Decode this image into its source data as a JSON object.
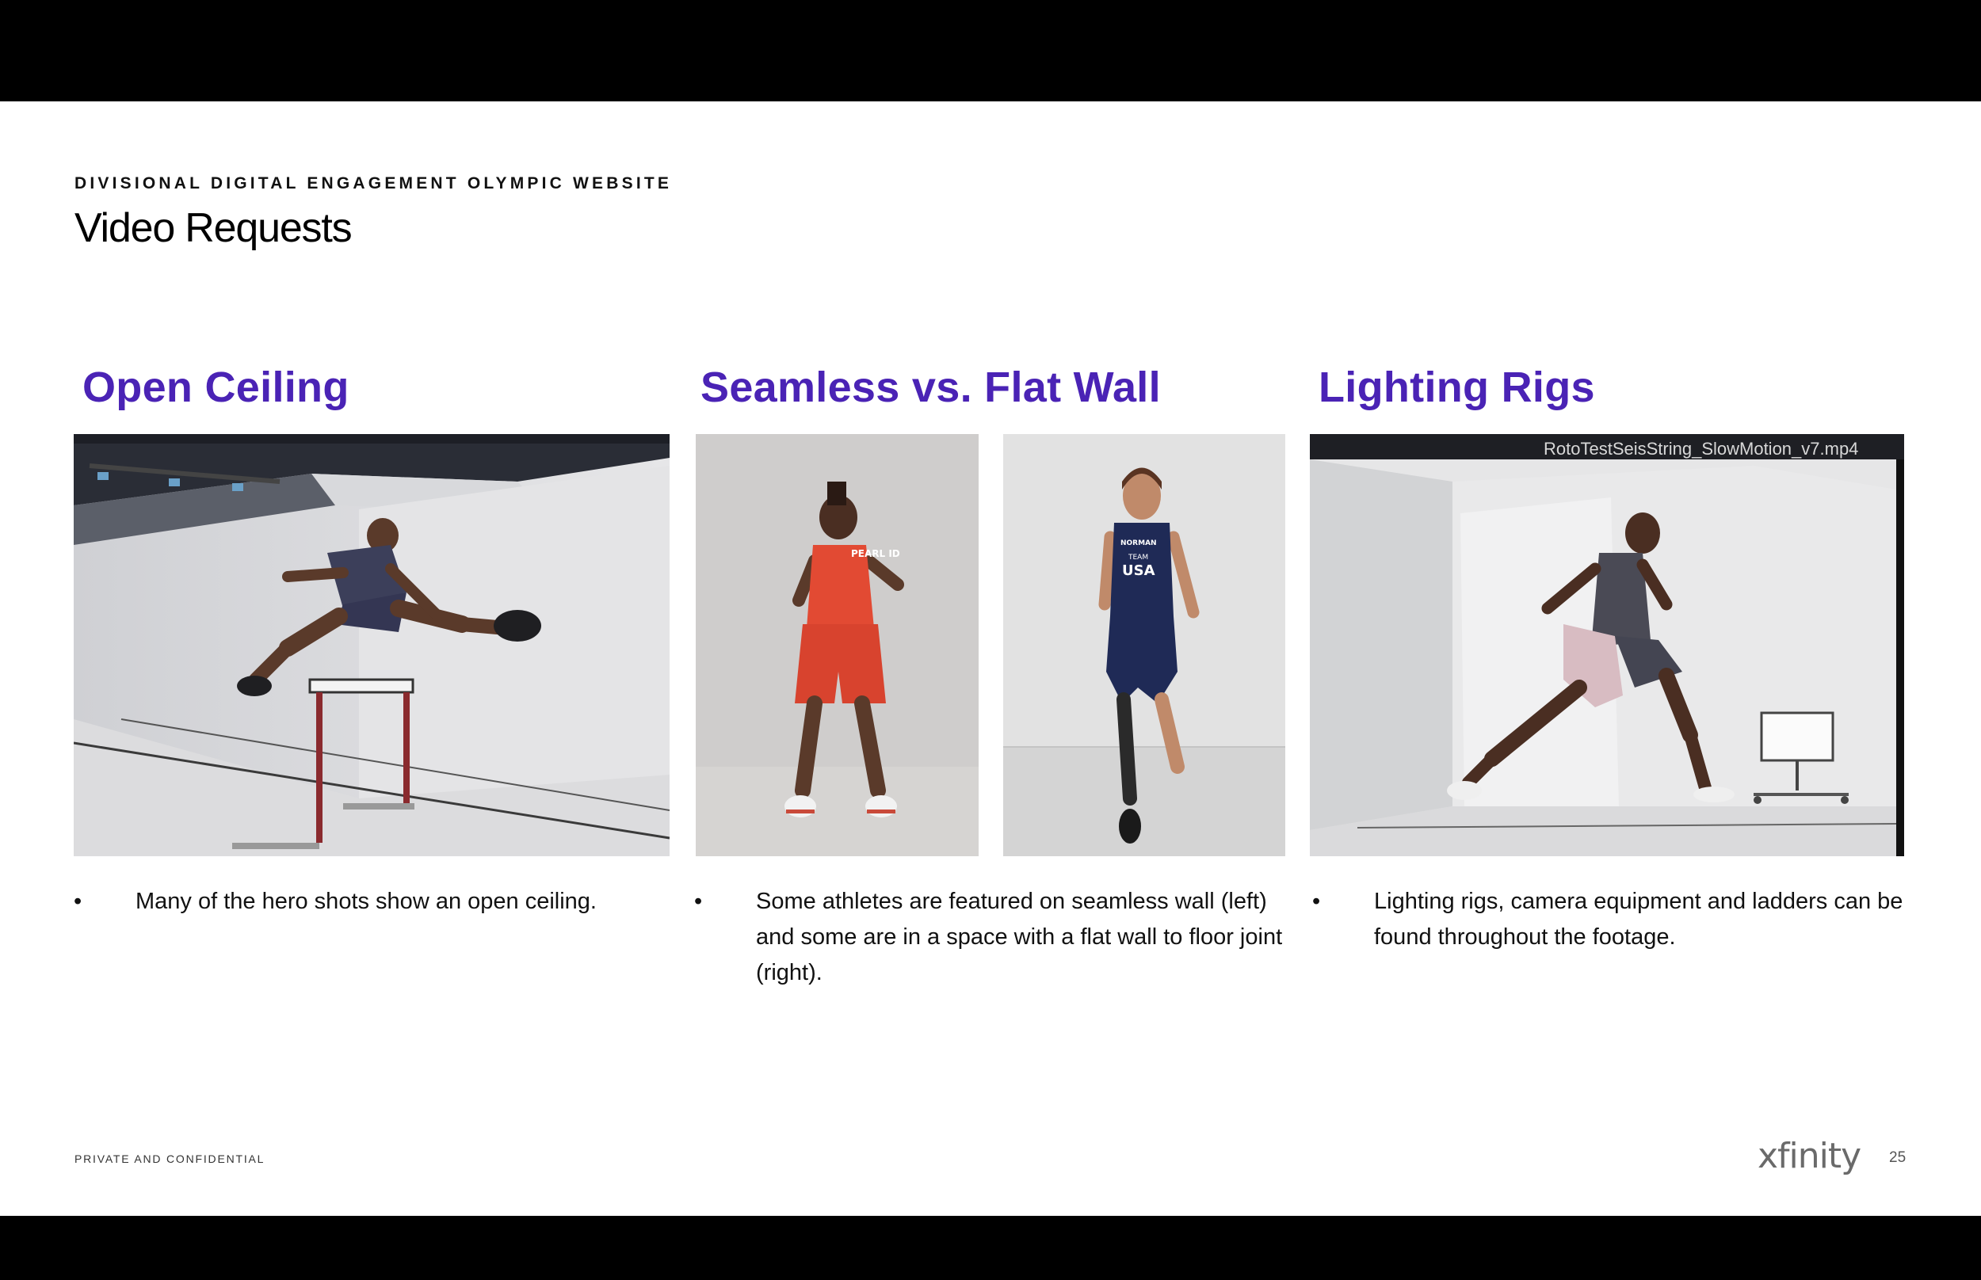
{
  "header": {
    "eyebrow": "DIVISIONAL DIGITAL ENGAGEMENT OLYMPIC WEBSITE",
    "title": "Video Requests"
  },
  "columns": [
    {
      "heading": "Open Ceiling",
      "bullet": "Many of the hero shots show an open ceiling."
    },
    {
      "heading": "Seamless vs. Flat Wall",
      "bullet_lines": [
        "Some athletes are featured on seamless wall (left)",
        "and some are in a space with a flat wall to floor joint",
        "(right)."
      ]
    },
    {
      "heading": "Lighting Rigs",
      "bullet_lines": [
        "Lighting rigs, camera equipment and ladders can be",
        "found throughout the footage."
      ],
      "video_filename": "RotoTestSeisString_SlowMotion_v7.mp4"
    }
  ],
  "images": {
    "jersey_text_left": "PEARL ID",
    "jersey_name_right": "NORMAN",
    "jersey_team_right": "TEAM",
    "jersey_country_right": "USA"
  },
  "footer": {
    "confidential": "PRIVATE AND CONFIDENTIAL",
    "logo": "xfinity",
    "page_number": "25"
  },
  "colors": {
    "accent": "#4a23b5",
    "studio_white": "#e8e8e8"
  },
  "bullet_glyph": "•"
}
